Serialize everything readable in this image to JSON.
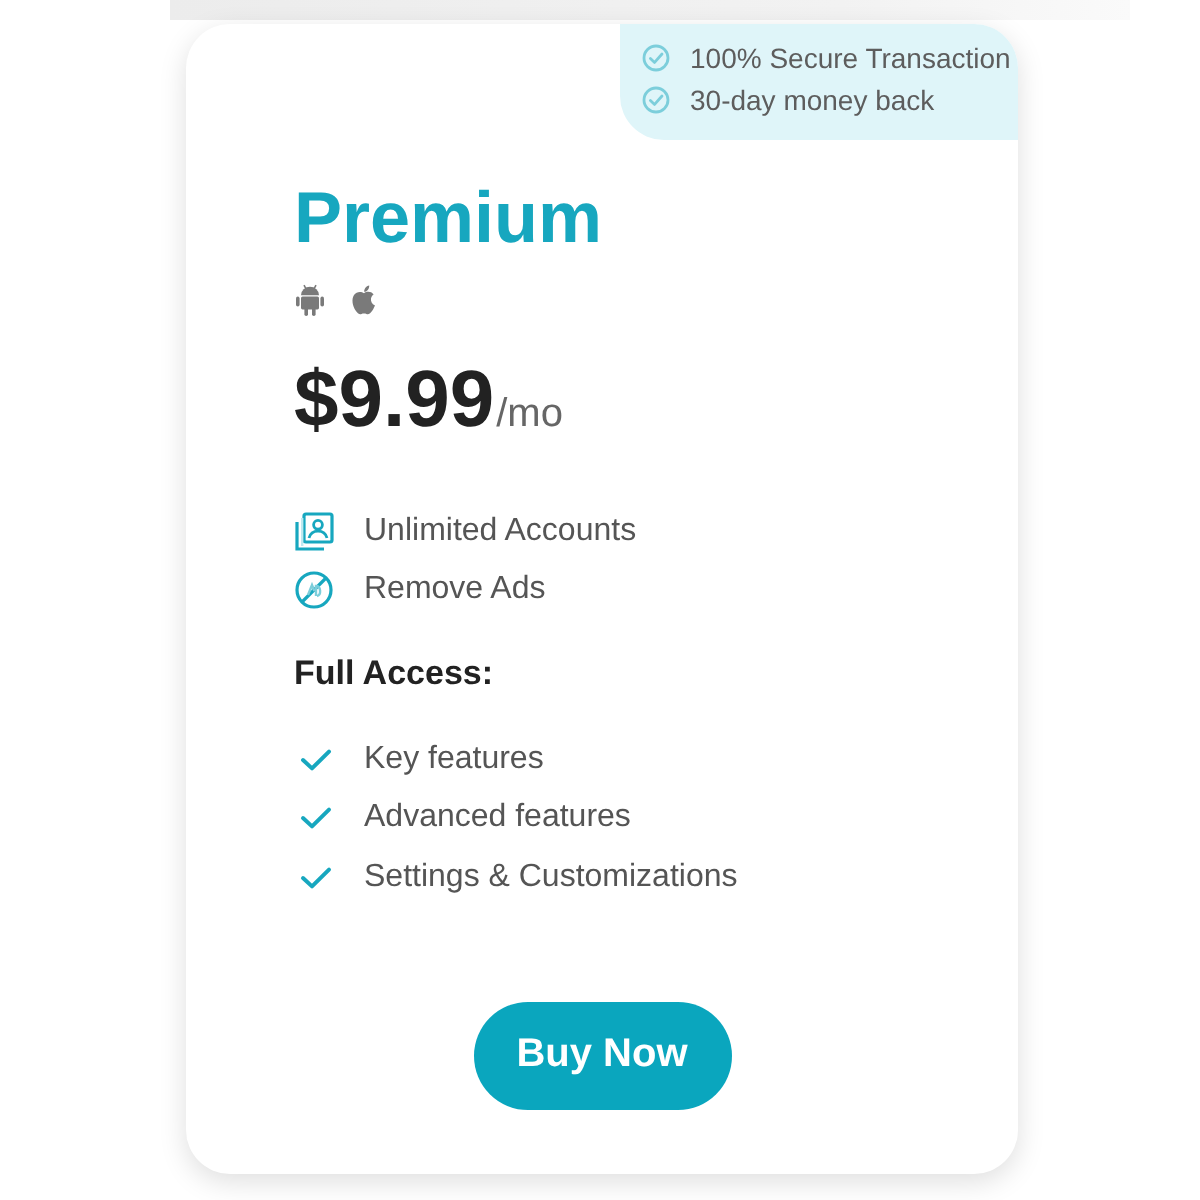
{
  "guarantees": [
    "100% Secure Transaction",
    "30-day money back"
  ],
  "plan": {
    "name": "Premium",
    "price": "$9.99",
    "period": "/mo"
  },
  "features": [
    "Unlimited Accounts",
    "Remove Ads"
  ],
  "full_access": {
    "heading": "Full Access:",
    "items": [
      "Key features",
      "Advanced features",
      "Settings & Customizations"
    ]
  },
  "button": "Buy Now"
}
